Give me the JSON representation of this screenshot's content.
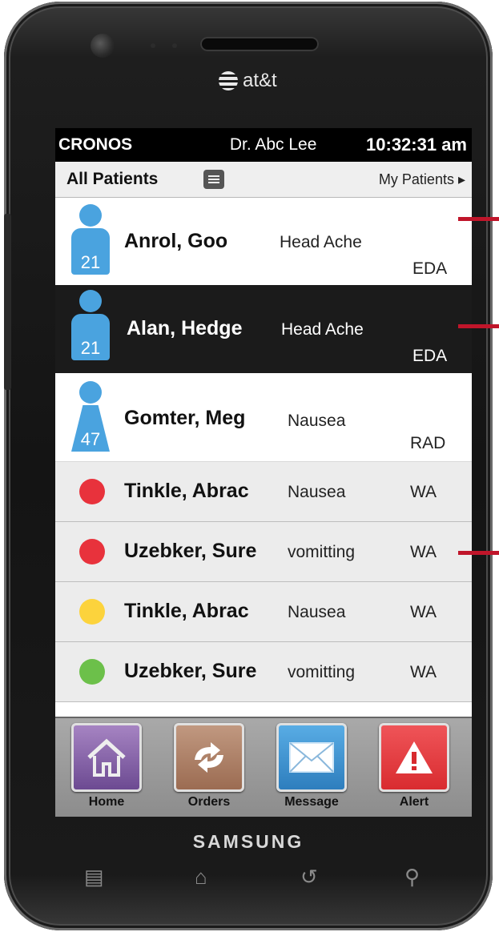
{
  "device": {
    "carrier": "at&t",
    "brand": "SAMSUNG"
  },
  "status_bar": {
    "app_name": "CRONOS",
    "doctor": "Dr. Abc Lee",
    "time": "10:32:31 am"
  },
  "header": {
    "all_patients": "All Patients",
    "my_patients": "My Patients ▸"
  },
  "patients": [
    {
      "name": "Anrol, Goo",
      "complaint": "Head Ache",
      "unit": "EDA",
      "age": "21",
      "style": "white",
      "icon": "male-person-icon"
    },
    {
      "name": "Alan, Hedge",
      "complaint": "Head Ache",
      "unit": "EDA",
      "age": "21",
      "style": "dark",
      "icon": "male-person-icon"
    },
    {
      "name": "Gomter, Meg",
      "complaint": "Nausea",
      "unit": "RAD",
      "age": "47",
      "style": "white",
      "icon": "female-person-icon"
    },
    {
      "name": "Tinkle, Abrac",
      "complaint": "Nausea",
      "unit": "WA",
      "status_color": "#e8323c"
    },
    {
      "name": "Uzebker, Sure",
      "complaint": "vomitting",
      "unit": "WA",
      "status_color": "#e8323c"
    },
    {
      "name": "Tinkle, Abrac",
      "complaint": "Nausea",
      "unit": "WA",
      "status_color": "#fcd33c"
    },
    {
      "name": "Uzebker, Sure",
      "complaint": "vomitting",
      "unit": "WA",
      "status_color": "#6cc04a"
    }
  ],
  "nav": [
    {
      "label": "Home",
      "icon": "home-icon",
      "color": "#8a63a8"
    },
    {
      "label": "Orders",
      "icon": "refresh-icon",
      "color": "#a87a5e"
    },
    {
      "label": "Message",
      "icon": "envelope-icon",
      "color": "#3b8fcf"
    },
    {
      "label": "Alert",
      "icon": "alert-icon",
      "color": "#e33a3a"
    }
  ],
  "colors": {
    "annotation": "#c0152a",
    "person_icon": "#4aa3df"
  }
}
